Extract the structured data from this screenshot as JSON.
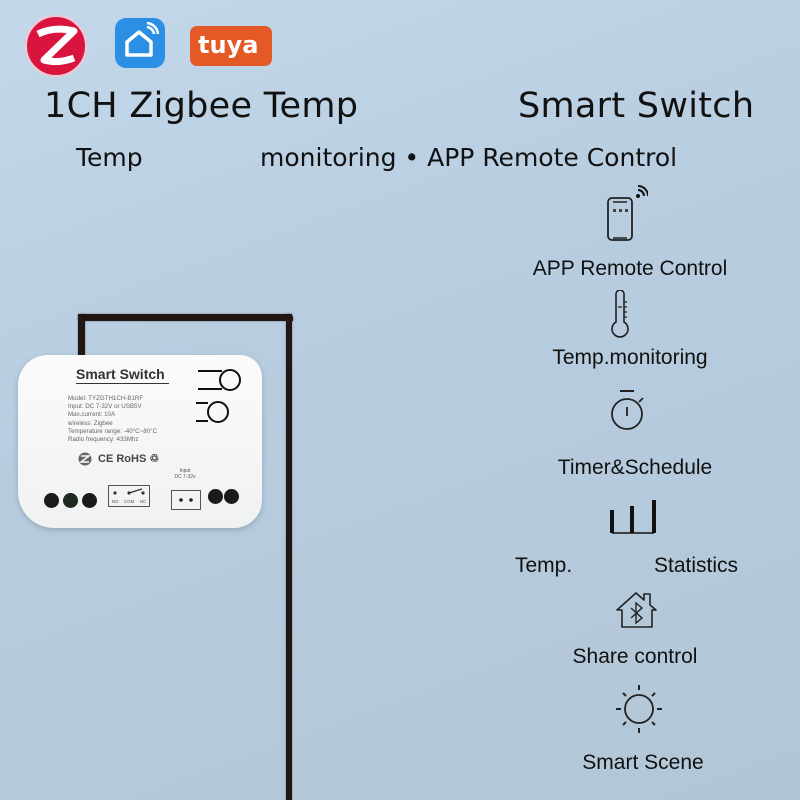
{
  "logos": {
    "zigbee": "zigbee-logo",
    "smartlife": "smart-life-home-logo",
    "tuya_text": "tuya"
  },
  "heading": {
    "line1_left": "1CH Zigbee Temp",
    "line1_right": "Smart Switch",
    "line2_left": "Temp",
    "line2_right": "monitoring • APP Remote Control"
  },
  "device": {
    "title": "Smart Switch",
    "specs": [
      "Model: TYZGTH1CH-B1RF",
      "Input: DC 7-32V or USB5V",
      "Max.current: 10A",
      "wireless: Zigbee",
      "Temperature range: -40°C~80°C",
      "Radio frequency: 433Mhz"
    ],
    "certs": "CE RoHS ♲",
    "relay_labels": [
      "NO",
      "COM",
      "NC"
    ],
    "input_label_1": "Input",
    "input_label_2": "DC 7-32v"
  },
  "features": [
    {
      "icon": "phone-wifi-icon",
      "label": "APP Remote Control"
    },
    {
      "icon": "thermometer-icon",
      "label": "Temp.monitoring"
    },
    {
      "icon": "stopwatch-icon",
      "label": "Timer&Schedule"
    },
    {
      "icon": "bar-chart-icon",
      "label_left": "Temp.",
      "label_right": "Statistics"
    },
    {
      "icon": "bluetooth-house-icon",
      "label": "Share control"
    },
    {
      "icon": "sun-icon",
      "label": "Smart Scene"
    }
  ],
  "colors": {
    "zigbee_red": "#d9143e",
    "smartlife_blue": "#2b8fe6",
    "tuya_orange": "#e35a26",
    "wire": "#231612"
  }
}
